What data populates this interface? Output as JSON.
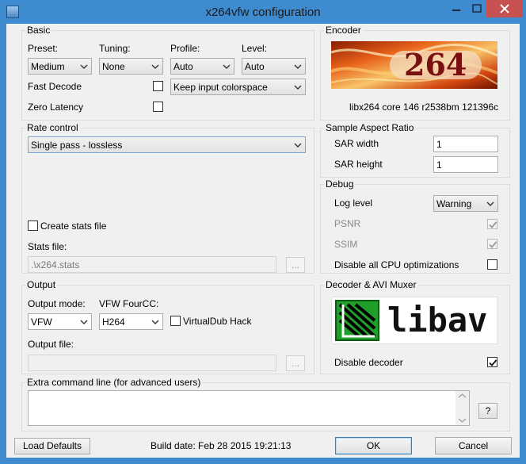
{
  "window": {
    "title": "x264vfw configuration"
  },
  "basic": {
    "group_label": "Basic",
    "preset_label": "Preset:",
    "preset_value": "Medium",
    "tuning_label": "Tuning:",
    "tuning_value": "None",
    "profile_label": "Profile:",
    "profile_value": "Auto",
    "level_label": "Level:",
    "level_value": "Auto",
    "fast_decode_label": "Fast Decode",
    "zero_latency_label": "Zero Latency",
    "colorspace_value": "Keep input colorspace"
  },
  "encoder": {
    "group_label": "Encoder",
    "logo_text": "264",
    "version_text": "libx264 core 146 r2538bm 121396c"
  },
  "rate_control": {
    "group_label": "Rate control",
    "mode_value": "Single pass - lossless",
    "create_stats_label": "Create stats file",
    "stats_file_label": "Stats file:",
    "stats_file_value": ".\\x264.stats",
    "browse_label": "..."
  },
  "sar": {
    "group_label": "Sample Aspect Ratio",
    "width_label": "SAR width",
    "width_value": "1",
    "height_label": "SAR height",
    "height_value": "1"
  },
  "debug": {
    "group_label": "Debug",
    "log_level_label": "Log level",
    "log_level_value": "Warning",
    "psnr_label": "PSNR",
    "ssim_label": "SSIM",
    "disable_cpu_label": "Disable all CPU optimizations"
  },
  "output": {
    "group_label": "Output",
    "mode_label": "Output mode:",
    "mode_value": "VFW",
    "fourcc_label": "VFW FourCC:",
    "fourcc_value": "H264",
    "virtualdub_label": "VirtualDub Hack",
    "file_label": "Output file:",
    "browse_label": "..."
  },
  "decoder": {
    "group_label": "Decoder & AVI Muxer",
    "logo_text": "libav",
    "disable_decoder_label": "Disable decoder"
  },
  "extra": {
    "group_label": "Extra command line (for advanced users)",
    "help_label": "?"
  },
  "footer": {
    "load_defaults_label": "Load Defaults",
    "build_date": "Build date: Feb 28 2015 19:21:13",
    "ok_label": "OK",
    "cancel_label": "Cancel"
  },
  "colors": {
    "title_bar": "#3f8bd0",
    "close_button": "#c75050",
    "dialog_bg": "#f0f0f0"
  }
}
